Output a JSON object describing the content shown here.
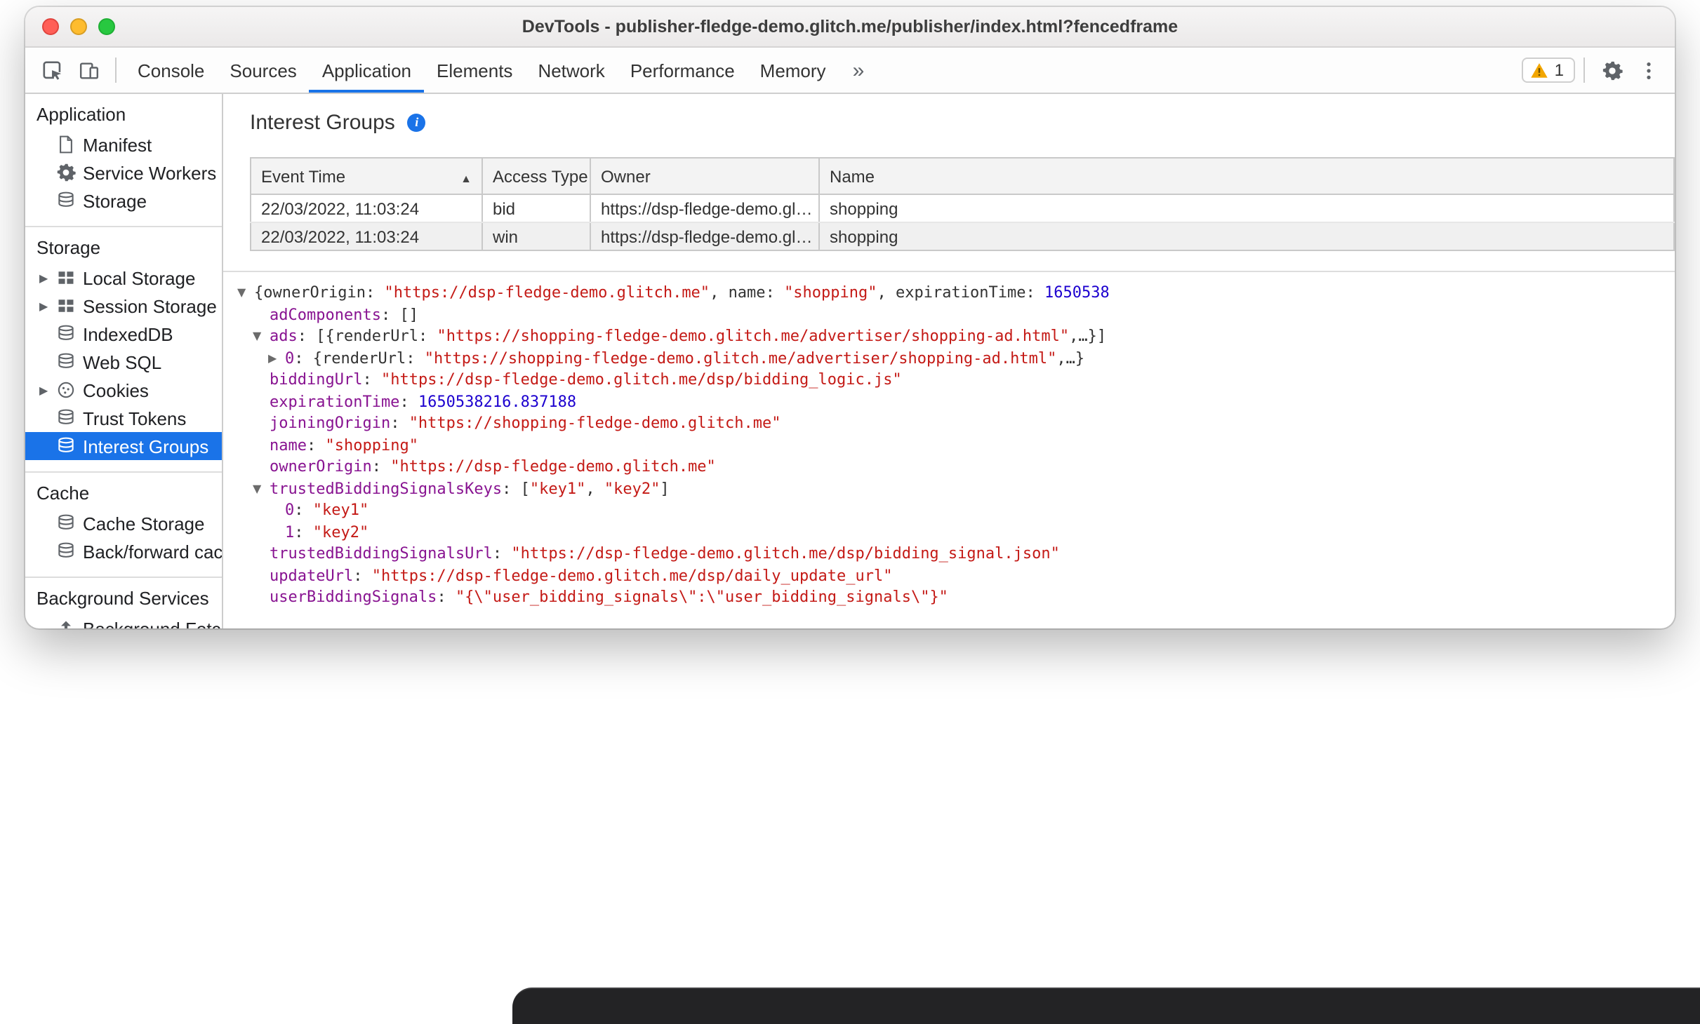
{
  "window": {
    "title": "DevTools - publisher-fledge-demo.glitch.me/publisher/index.html?fencedframe"
  },
  "colors": {
    "accent": "#1a73e8",
    "warning": "#f2a600",
    "tree_key": "#881391",
    "tree_string": "#c41a16",
    "tree_number": "#1c00cf"
  },
  "glyphs": {
    "more_tabs": "»",
    "collapse": "▶",
    "expand": "▼",
    "sort_asc": "▲",
    "info": "i"
  },
  "toolbar": {
    "tabs": [
      "Console",
      "Sources",
      "Application",
      "Elements",
      "Network",
      "Performance",
      "Memory"
    ],
    "active_tab": "Application",
    "warning_count": "1"
  },
  "sidebar": {
    "sections": [
      {
        "title": "Application",
        "items": [
          {
            "label": "Manifest",
            "icon": "manifest-icon"
          },
          {
            "label": "Service Workers",
            "icon": "service-worker-icon"
          },
          {
            "label": "Storage",
            "icon": "database-icon"
          }
        ]
      },
      {
        "title": "Storage",
        "items": [
          {
            "label": "Local Storage",
            "icon": "table-icon",
            "expandable": true
          },
          {
            "label": "Session Storage",
            "icon": "table-icon",
            "expandable": true
          },
          {
            "label": "IndexedDB",
            "icon": "database-icon"
          },
          {
            "label": "Web SQL",
            "icon": "database-icon"
          },
          {
            "label": "Cookies",
            "icon": "cookie-icon",
            "expandable": true
          },
          {
            "label": "Trust Tokens",
            "icon": "database-icon"
          },
          {
            "label": "Interest Groups",
            "icon": "database-icon",
            "selected": true
          }
        ]
      },
      {
        "title": "Cache",
        "items": [
          {
            "label": "Cache Storage",
            "icon": "database-icon"
          },
          {
            "label": "Back/forward cache",
            "icon": "database-icon"
          }
        ]
      },
      {
        "title": "Background Services",
        "items": [
          {
            "label": "Background Fetch",
            "icon": "background-fetch-icon"
          }
        ]
      }
    ]
  },
  "main": {
    "title": "Interest Groups",
    "table": {
      "columns": [
        "Event Time",
        "Access Type",
        "Owner",
        "Name"
      ],
      "sorted_column": "Event Time",
      "sort_direction": "asc",
      "rows": [
        [
          "22/03/2022, 11:03:24",
          "bid",
          "https://dsp-fledge-demo.gl…",
          "shopping"
        ],
        [
          "22/03/2022, 11:03:24",
          "win",
          "https://dsp-fledge-demo.gl…",
          "shopping"
        ]
      ]
    },
    "tree": {
      "lines": [
        {
          "depth": 0,
          "marker": "expanded",
          "segments": [
            [
              "p",
              "{"
            ],
            [
              "pk",
              "ownerOrigin"
            ],
            [
              "p",
              ": "
            ],
            [
              "s",
              "\"https://dsp-fledge-demo.glitch.me\""
            ],
            [
              "p",
              ", "
            ],
            [
              "pk",
              "name"
            ],
            [
              "p",
              ": "
            ],
            [
              "s",
              "\"shopping\""
            ],
            [
              "p",
              ", "
            ],
            [
              "pk",
              "expirationTime"
            ],
            [
              "p",
              ": "
            ],
            [
              "n",
              "1650538"
            ]
          ]
        },
        {
          "depth": 1,
          "marker": "none",
          "segments": [
            [
              "k",
              "adComponents"
            ],
            [
              "p",
              ": []"
            ]
          ]
        },
        {
          "depth": 1,
          "marker": "expanded",
          "segments": [
            [
              "k",
              "ads"
            ],
            [
              "p",
              ": [{"
            ],
            [
              "pk",
              "renderUrl"
            ],
            [
              "p",
              ": "
            ],
            [
              "s",
              "\"https://shopping-fledge-demo.glitch.me/advertiser/shopping-ad.html\""
            ],
            [
              "p",
              ",…}]"
            ]
          ]
        },
        {
          "depth": 2,
          "marker": "collapsed",
          "segments": [
            [
              "k",
              "0"
            ],
            [
              "p",
              ": {"
            ],
            [
              "pk",
              "renderUrl"
            ],
            [
              "p",
              ": "
            ],
            [
              "s",
              "\"https://shopping-fledge-demo.glitch.me/advertiser/shopping-ad.html\""
            ],
            [
              "p",
              ",…}"
            ]
          ]
        },
        {
          "depth": 1,
          "marker": "none",
          "segments": [
            [
              "k",
              "biddingUrl"
            ],
            [
              "p",
              ": "
            ],
            [
              "s",
              "\"https://dsp-fledge-demo.glitch.me/dsp/bidding_logic.js\""
            ]
          ]
        },
        {
          "depth": 1,
          "marker": "none",
          "segments": [
            [
              "k",
              "expirationTime"
            ],
            [
              "p",
              ": "
            ],
            [
              "n",
              "1650538216.837188"
            ]
          ]
        },
        {
          "depth": 1,
          "marker": "none",
          "segments": [
            [
              "k",
              "joiningOrigin"
            ],
            [
              "p",
              ": "
            ],
            [
              "s",
              "\"https://shopping-fledge-demo.glitch.me\""
            ]
          ]
        },
        {
          "depth": 1,
          "marker": "none",
          "segments": [
            [
              "k",
              "name"
            ],
            [
              "p",
              ": "
            ],
            [
              "s",
              "\"shopping\""
            ]
          ]
        },
        {
          "depth": 1,
          "marker": "none",
          "segments": [
            [
              "k",
              "ownerOrigin"
            ],
            [
              "p",
              ": "
            ],
            [
              "s",
              "\"https://dsp-fledge-demo.glitch.me\""
            ]
          ]
        },
        {
          "depth": 1,
          "marker": "expanded",
          "segments": [
            [
              "k",
              "trustedBiddingSignalsKeys"
            ],
            [
              "p",
              ": ["
            ],
            [
              "s",
              "\"key1\""
            ],
            [
              "p",
              ", "
            ],
            [
              "s",
              "\"key2\""
            ],
            [
              "p",
              "]"
            ]
          ]
        },
        {
          "depth": 2,
          "marker": "none",
          "segments": [
            [
              "k",
              "0"
            ],
            [
              "p",
              ": "
            ],
            [
              "s",
              "\"key1\""
            ]
          ]
        },
        {
          "depth": 2,
          "marker": "none",
          "segments": [
            [
              "k",
              "1"
            ],
            [
              "p",
              ": "
            ],
            [
              "s",
              "\"key2\""
            ]
          ]
        },
        {
          "depth": 1,
          "marker": "none",
          "segments": [
            [
              "k",
              "trustedBiddingSignalsUrl"
            ],
            [
              "p",
              ": "
            ],
            [
              "s",
              "\"https://dsp-fledge-demo.glitch.me/dsp/bidding_signal.json\""
            ]
          ]
        },
        {
          "depth": 1,
          "marker": "none",
          "segments": [
            [
              "k",
              "updateUrl"
            ],
            [
              "p",
              ": "
            ],
            [
              "s",
              "\"https://dsp-fledge-demo.glitch.me/dsp/daily_update_url\""
            ]
          ]
        },
        {
          "depth": 1,
          "marker": "none",
          "segments": [
            [
              "k",
              "userBiddingSignals"
            ],
            [
              "p",
              ": "
            ],
            [
              "s",
              "\"{\\\"user_bidding_signals\\\":\\\"user_bidding_signals\\\"}\""
            ]
          ]
        }
      ]
    }
  }
}
